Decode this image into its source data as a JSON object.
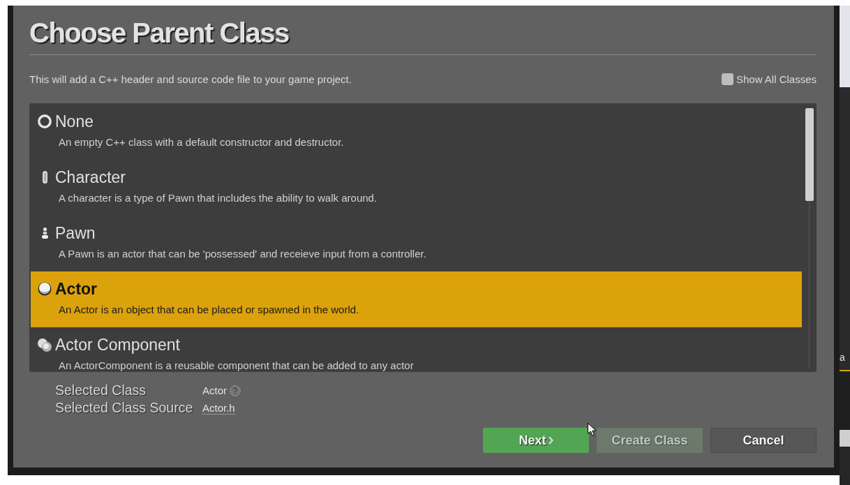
{
  "title": "Choose Parent Class",
  "description": "This will add a C++ header and source code file to your game project.",
  "show_all_classes": {
    "label": "Show All Classes",
    "checked": false
  },
  "classes": [
    {
      "kind": "none",
      "name": "None",
      "description": "An empty C++ class with a default constructor and destructor.",
      "selected": false
    },
    {
      "kind": "character",
      "name": "Character",
      "description": "A character is a type of Pawn that includes the ability to walk around.",
      "selected": false
    },
    {
      "kind": "pawn",
      "name": "Pawn",
      "description": "A Pawn is an actor that can be 'possessed' and receieve input from a controller.",
      "selected": false
    },
    {
      "kind": "actor",
      "name": "Actor",
      "description": "An Actor is an object that can be placed or spawned in the world.",
      "selected": true
    },
    {
      "kind": "component",
      "name": "Actor Component",
      "description": "An ActorComponent is a reusable component that can be added to any actor",
      "selected": false
    }
  ],
  "details": [
    {
      "kind": "class",
      "label": "Selected Class",
      "value": "Actor"
    },
    {
      "kind": "file",
      "label": "Selected Class Source",
      "value": "Actor.h"
    }
  ],
  "buttons": [
    {
      "kind": "next",
      "label": "Next",
      "disabled": false
    },
    {
      "kind": "create",
      "label": "Create Class",
      "disabled": true
    },
    {
      "kind": "cancel",
      "label": "Cancel",
      "disabled": false
    }
  ],
  "background_editor": {
    "text": "a"
  }
}
